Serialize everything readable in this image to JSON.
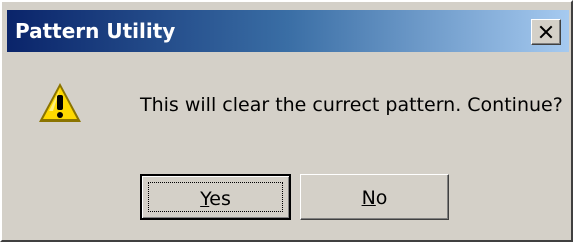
{
  "window": {
    "title": "Pattern Utility"
  },
  "message": {
    "text": "This will clear the currect pattern. Continue?",
    "icon": "warning-icon"
  },
  "buttons": {
    "yes": {
      "mnemonic": "Y",
      "rest": "es"
    },
    "no": {
      "mnemonic": "N",
      "rest": "o"
    }
  },
  "colors": {
    "face": "#d4d0c8",
    "title_start": "#0a246a",
    "title_end": "#a6caf0",
    "warning": "#ffd900"
  }
}
